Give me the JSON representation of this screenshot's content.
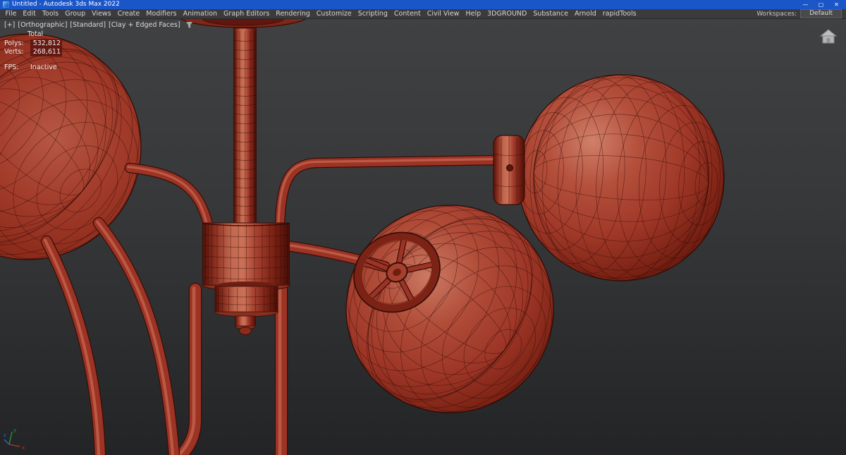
{
  "window": {
    "title": "Untitled - Autodesk 3ds Max 2022",
    "controls": {
      "minimize": "—",
      "maximize": "▢",
      "close": "✕"
    }
  },
  "menubar": {
    "items": [
      "File",
      "Edit",
      "Tools",
      "Group",
      "Views",
      "Create",
      "Modifiers",
      "Animation",
      "Graph Editors",
      "Rendering",
      "Customize",
      "Scripting",
      "Content",
      "Civil View",
      "Help",
      "3DGROUND",
      "Substance",
      "Arnold",
      "rapidTools"
    ],
    "workspaces_label": "Workspaces:",
    "workspaces_value": "Default"
  },
  "viewport": {
    "labels": [
      "[+]",
      "[Orthographic]",
      "[Standard]",
      "[Clay + Edged Faces]"
    ],
    "stats": {
      "total_label": "Total",
      "polys_label": "Polys:",
      "polys_value": "532,812",
      "verts_label": "Verts:",
      "verts_value": "268,611",
      "fps_label": "FPS:",
      "fps_value": "Inactive"
    },
    "axis": {
      "x": "x",
      "y": "y",
      "z": "z"
    }
  },
  "colors": {
    "titlebar_bg": "#1b56c9",
    "menubar_bg": "#3b3b3d",
    "viewport_top": "#404143",
    "viewport_bottom": "#232426",
    "clay_base": "#9c3425",
    "clay_highlight": "#ca7156",
    "clay_shadow": "#561208",
    "wireframe": "#300a06"
  }
}
